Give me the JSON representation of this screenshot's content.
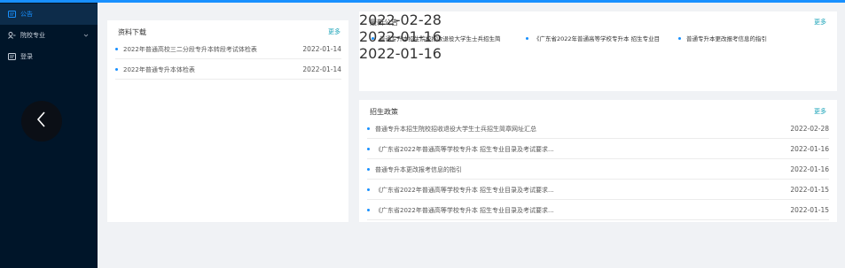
{
  "sidebar": {
    "items": [
      {
        "label": "公告",
        "icon": "announcement-icon",
        "active": true
      },
      {
        "label": "院校专业",
        "icon": "school-icon",
        "has_submenu": true
      },
      {
        "label": "登录",
        "icon": "login-icon"
      }
    ]
  },
  "downloads": {
    "title": "资料下载",
    "more": "更多",
    "rows": [
      {
        "text": "2022年普通高校三二分段专升本转段考试体检表",
        "date": "2022-01-14"
      },
      {
        "text": "2022年普通专升本体检表",
        "date": "2022-01-14"
      }
    ]
  },
  "news": {
    "title": "最新公告",
    "more": "更多",
    "items": [
      {
        "text": "普通专升本招生院校招收退役大学生士兵招生简",
        "date": "2022-02-28"
      },
      {
        "text": "《广东省2022年普通高等学校专升本 招生专业目",
        "date": "2022-01-16"
      },
      {
        "text": "普通专升本更改报考信息的指引",
        "date": "2022-01-16"
      }
    ]
  },
  "policy": {
    "title": "招生政策",
    "more": "更多",
    "rows": [
      {
        "text": "普通专升本招生院校招收退役大学生士兵招生简章网址汇总",
        "date": "2022-02-28"
      },
      {
        "text": "《广东省2022年普通高等学校专升本 招生专业目录及考试要求...",
        "date": "2022-01-16"
      },
      {
        "text": "普通专升本更改报考信息的指引",
        "date": "2022-01-16"
      },
      {
        "text": "《广东省2022年普通高等学校专升本 招生专业目录及考试要求...",
        "date": "2022-01-15"
      },
      {
        "text": "《广东省2022年普通高等学校专升本 招生专业目录及考试要求...",
        "date": "2022-01-15"
      }
    ]
  },
  "colors": {
    "accent": "#1890ff",
    "sidebar_bg": "#001529",
    "more_link": "#1aa3b8"
  }
}
